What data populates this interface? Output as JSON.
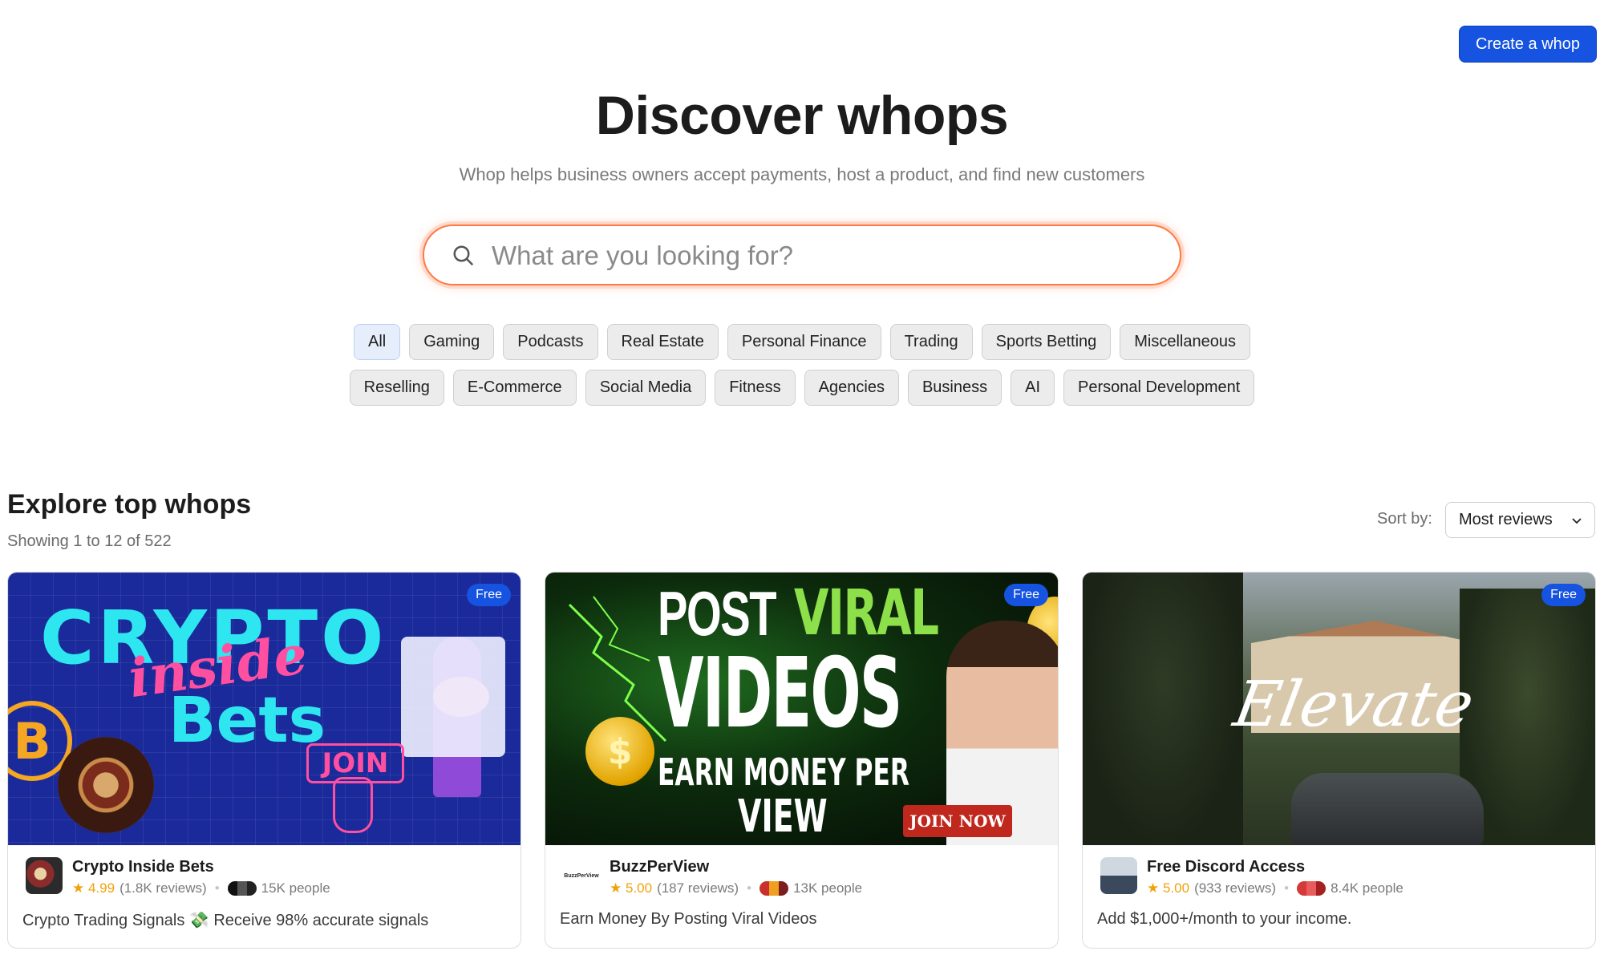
{
  "header": {
    "create_label": "Create a whop"
  },
  "hero": {
    "title": "Discover whops",
    "subtitle": "Whop helps business owners accept payments, host a product, and find new customers"
  },
  "search": {
    "placeholder": "What are you looking for?",
    "value": ""
  },
  "categories": {
    "row1": [
      "All",
      "Gaming",
      "Podcasts",
      "Real Estate",
      "Personal Finance",
      "Trading",
      "Sports Betting",
      "Miscellaneous"
    ],
    "row2": [
      "Reselling",
      "E-Commerce",
      "Social Media",
      "Fitness",
      "Agencies",
      "Business",
      "AI",
      "Personal Development"
    ],
    "active": "All"
  },
  "section": {
    "title": "Explore top whops",
    "count": "Showing 1 to 12 of 522",
    "sort_label": "Sort by:",
    "sort_value": "Most reviews"
  },
  "cards": [
    {
      "badge": "Free",
      "name": "Crypto Inside Bets",
      "rating": "★ 4.99",
      "reviews": "(1.8K reviews)",
      "people": "15K people",
      "description": "Crypto Trading Signals 💸 Receive 98% accurate signals",
      "banner": {
        "line1": "CRYPTO",
        "line2": "inside",
        "line3": "Bets",
        "cta": "JOIN"
      }
    },
    {
      "badge": "Free",
      "name": "BuzzPerView",
      "rating": "★ 5.00",
      "reviews": "(187 reviews)",
      "people": "13K people",
      "description": "Earn Money By Posting Viral Videos",
      "banner": {
        "line1a": "POST",
        "line1b": "VIRAL",
        "line2": "VIDEOS",
        "line3": "EARN MONEY PER",
        "line4": "VIEW",
        "cta": "JOIN NOW"
      }
    },
    {
      "badge": "Free",
      "name": "Free Discord Access",
      "rating": "★ 5.00",
      "reviews": "(933 reviews)",
      "people": "8.4K people",
      "description": "Add $1,000+/month to your income.",
      "banner": {
        "script": "Elevate"
      }
    }
  ],
  "colors": {
    "accent": "#1553e0",
    "search_glow": "#ff7a45",
    "star": "#f0a20b"
  }
}
